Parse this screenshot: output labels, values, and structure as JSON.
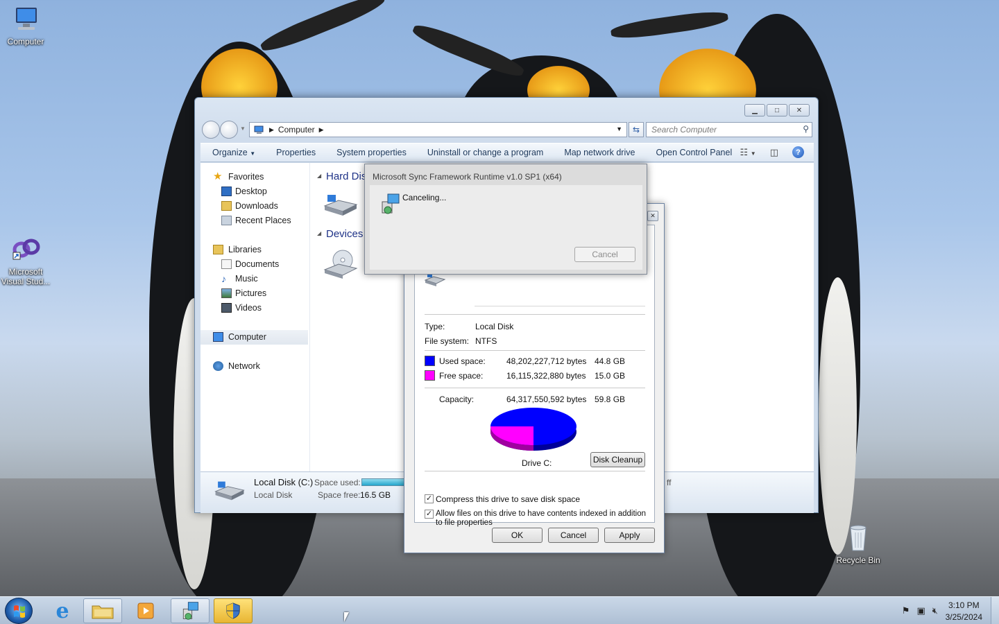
{
  "desktop": {
    "icons": [
      {
        "label": "Computer"
      },
      {
        "label": "Microsoft Visual Stud..."
      },
      {
        "label": "Recycle Bin"
      }
    ]
  },
  "explorer": {
    "address": "Computer",
    "search_placeholder": "Search Computer",
    "toolbar": [
      "Organize",
      "Properties",
      "System properties",
      "Uninstall or change a program",
      "Map network drive",
      "Open Control Panel"
    ],
    "nav": {
      "favorites": "Favorites",
      "favorites_items": [
        "Desktop",
        "Downloads",
        "Recent Places"
      ],
      "libraries": "Libraries",
      "libraries_items": [
        "Documents",
        "Music",
        "Pictures",
        "Videos"
      ],
      "computer": "Computer",
      "network": "Network"
    },
    "groups": {
      "hard_disk": "Hard Dis",
      "devices": "Devices"
    },
    "details": {
      "name": "Local Disk (C:)",
      "type": "Local Disk",
      "space_used_label": "Space used:",
      "space_free_label": "Space free:",
      "space_free_value": "16.5 GB",
      "fragment": "ff"
    }
  },
  "properties": {
    "type_label": "Type:",
    "type_value": "Local Disk",
    "fs_label": "File system:",
    "fs_value": "NTFS",
    "used_label": "Used space:",
    "used_bytes": "48,202,227,712 bytes",
    "used_gb": "44.8 GB",
    "free_label": "Free space:",
    "free_bytes": "16,115,322,880 bytes",
    "free_gb": "15.0 GB",
    "capacity_label": "Capacity:",
    "capacity_bytes": "64,317,550,592 bytes",
    "capacity_gb": "59.8 GB",
    "drive_label": "Drive C:",
    "disk_cleanup": "Disk Cleanup",
    "compress_label": "Compress this drive to save disk space",
    "index_label": "Allow files on this drive to have contents indexed in addition to file properties",
    "ok": "OK",
    "cancel": "Cancel",
    "apply": "Apply",
    "used_fraction": 0.75,
    "colors": {
      "used": "#0000ff",
      "free": "#ff00ff"
    }
  },
  "installer": {
    "title": "Microsoft Sync Framework Runtime v1.0 SP1 (x64)",
    "status": "Canceling...",
    "cancel": "Cancel"
  },
  "taskbar": {
    "time": "3:10 PM",
    "date": "3/25/2024"
  }
}
